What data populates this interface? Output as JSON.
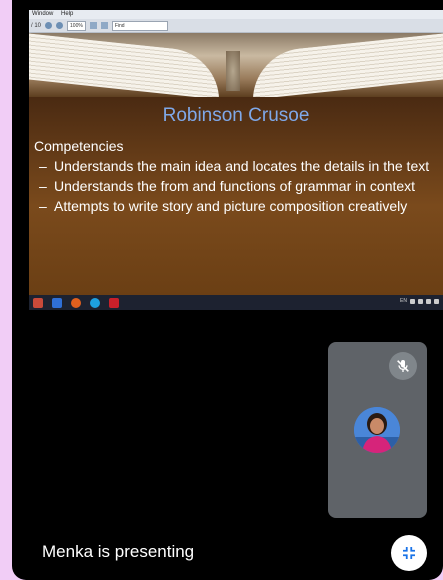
{
  "pdf_viewer": {
    "menu_items": [
      "Window",
      "Help"
    ],
    "page_indicator": "/ 10",
    "zoom_level": "100%",
    "find_placeholder": "Find"
  },
  "slide": {
    "title": "Robinson Crusoe",
    "heading": "Competencies",
    "bullets": [
      "Understands the main idea and locates the details in the text",
      "Understands the from and functions of grammar in context",
      "Attempts to write story and picture composition creatively"
    ]
  },
  "taskbar": {
    "tray_language": "EN"
  },
  "meeting": {
    "presenting_status": "Menka is presenting",
    "mic_state": "muted"
  },
  "colors": {
    "page_background": "#f1cdf6",
    "call_background": "#000000",
    "self_tile": "#5f6368",
    "slide_title": "#7fa8e8"
  }
}
